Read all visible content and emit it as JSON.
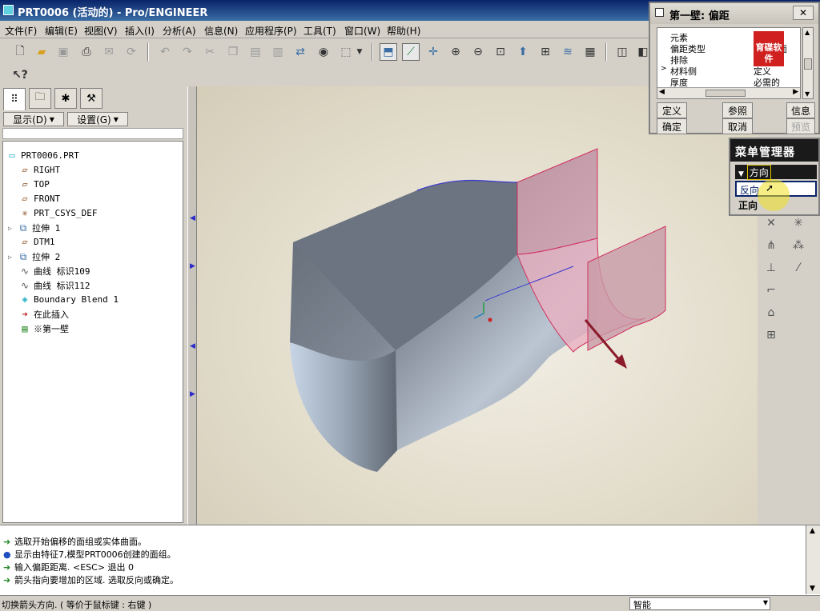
{
  "title_bar": {
    "title": "PRT0006 (活动的) - Pro/ENGINEER"
  },
  "menu_bar": {
    "items": [
      "文件(F)",
      "编辑(E)",
      "视图(V)",
      "插入(I)",
      "分析(A)",
      "信息(N)",
      "应用程序(P)",
      "工具(T)",
      "窗口(W)",
      "帮助(H)"
    ]
  },
  "toolbar": {
    "icons": [
      "new-icon",
      "open-icon",
      "save-icon",
      "print-icon",
      "send-icon",
      "save-copy-icon",
      "undo-icon",
      "redo-icon",
      "cut-icon",
      "copy-icon",
      "paste-icon",
      "paste-special-icon",
      "regenerate-icon",
      "find-icon",
      "select-box-icon",
      "datum-display-icon",
      "axis-display-icon",
      "point-display-icon",
      "zoom-in-icon",
      "zoom-out-icon",
      "refit-icon",
      "orient-icon",
      "view-list-icon",
      "layers-icon",
      "view-manager-icon",
      "shading-icon"
    ]
  },
  "left_panel": {
    "tabs": [
      "model-tree-tab",
      "layer-tab",
      "favorites-tab",
      "tools-tab"
    ],
    "show_button": "显示(D)",
    "settings_button": "设置(G)",
    "tree": [
      {
        "label": "PRT0006.PRT",
        "icon": "part-icon",
        "indent": 0,
        "expand": false
      },
      {
        "label": "RIGHT",
        "icon": "datum-plane-icon",
        "indent": 1,
        "expand": false
      },
      {
        "label": "TOP",
        "icon": "datum-plane-icon",
        "indent": 1,
        "expand": false
      },
      {
        "label": "FRONT",
        "icon": "datum-plane-icon",
        "indent": 1,
        "expand": false
      },
      {
        "label": "PRT_CSYS_DEF",
        "icon": "csys-icon",
        "indent": 1,
        "expand": false
      },
      {
        "label": "拉伸 1",
        "icon": "extrude-icon",
        "indent": 1,
        "expand": true
      },
      {
        "label": "DTM1",
        "icon": "datum-plane-icon",
        "indent": 1,
        "expand": false
      },
      {
        "label": "拉伸 2",
        "icon": "extrude-icon",
        "indent": 1,
        "expand": true
      },
      {
        "label": "曲线 标识109",
        "icon": "curve-icon",
        "indent": 1,
        "expand": false
      },
      {
        "label": "曲线 标识112",
        "icon": "curve-icon",
        "indent": 1,
        "expand": false
      },
      {
        "label": "Boundary Blend 1",
        "icon": "boundary-blend-icon",
        "indent": 1,
        "expand": false
      },
      {
        "label": "在此插入",
        "icon": "insert-here-icon",
        "indent": 1,
        "expand": false
      },
      {
        "label": "※第一壁",
        "icon": "first-wall-icon",
        "indent": 1,
        "expand": false
      }
    ]
  },
  "dialog": {
    "title": "第一壁: 偏距",
    "columns": [
      "元素",
      "信息"
    ],
    "rows": [
      {
        "element": "元素",
        "info": ""
      },
      {
        "element": "偏距类型",
        "info": "曲面"
      },
      {
        "element": "排除",
        "info": ""
      },
      {
        "element": "材料侧",
        "info": "定义"
      },
      {
        "element": "厚度",
        "info": "必需的"
      }
    ],
    "watermark_text": "育碟软件",
    "buttons": {
      "define": "定义",
      "refs": "参照",
      "info": "信息",
      "ok": "确定",
      "cancel": "取消",
      "preview": "预览"
    }
  },
  "menu_manager": {
    "title": "菜单管理器",
    "section": "方向",
    "items": [
      {
        "label": "反向",
        "highlighted": true
      },
      {
        "label": "正向",
        "highlighted": false
      }
    ]
  },
  "messages": [
    {
      "icon": "prompt-arrow-icon",
      "text": "选取开始偏移的面组或实体曲面。"
    },
    {
      "icon": "info-dot-icon",
      "text": "显示由特征7,模型PRT0006创建的面组。"
    },
    {
      "icon": "prompt-arrow-icon",
      "text": "输入偏距距离. <ESC> 退出  0"
    },
    {
      "icon": "prompt-arrow-icon",
      "text": "箭头指向要增加的区域. 选取反向或确定。"
    }
  ],
  "status_bar": {
    "text": "切换箭头方向.  ( 等价于鼠标键 : 右键 )",
    "filter_value": "智能"
  },
  "colors": {
    "title_bar": "#0a246a",
    "surface_gray": "#6b7480",
    "wall_pink": "#d25a80",
    "arrow_red": "#8b1a2a"
  }
}
